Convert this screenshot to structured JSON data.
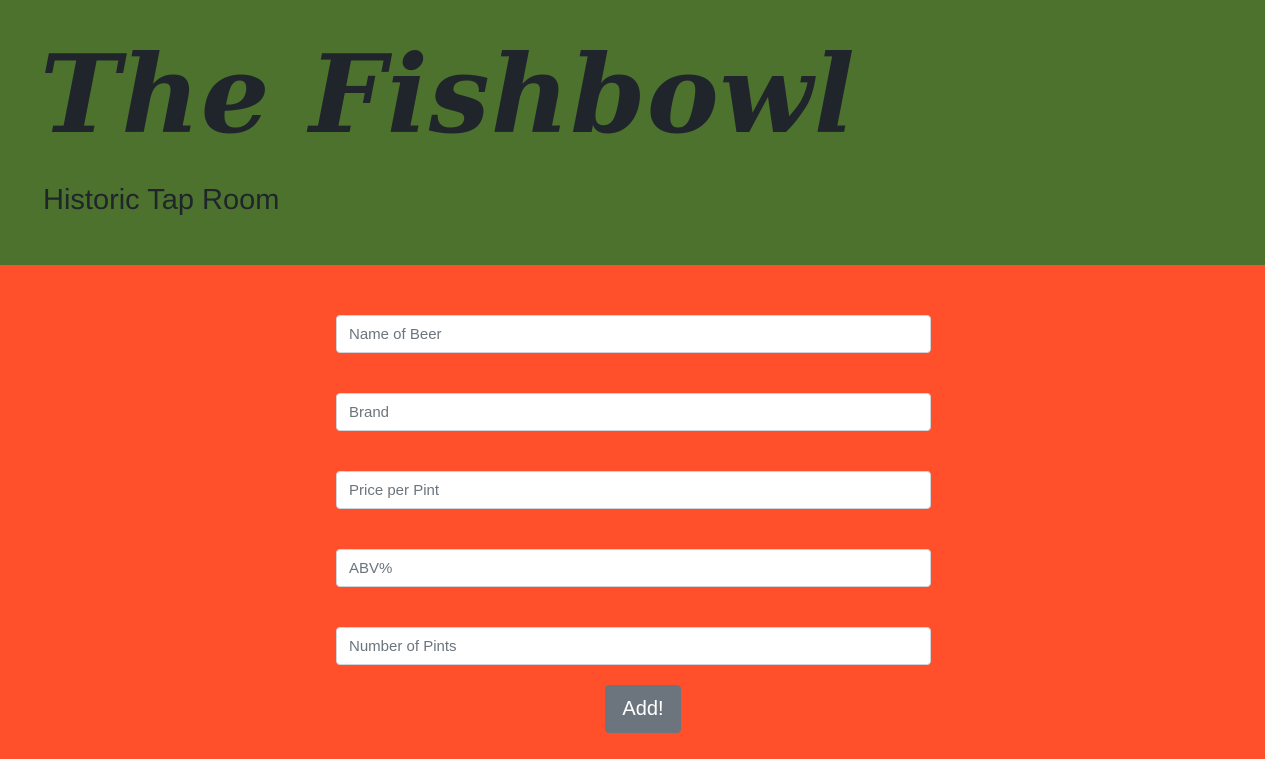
{
  "header": {
    "title": "The Fishbowl",
    "subtitle": "Historic Tap Room"
  },
  "form": {
    "fields": [
      {
        "name": "beer-name-input",
        "placeholder": "Name of Beer",
        "value": ""
      },
      {
        "name": "brand-input",
        "placeholder": "Brand",
        "value": ""
      },
      {
        "name": "price-input",
        "placeholder": "Price per Pint",
        "value": ""
      },
      {
        "name": "abv-input",
        "placeholder": "ABV%",
        "value": ""
      },
      {
        "name": "pints-input",
        "placeholder": "Number of Pints",
        "value": ""
      }
    ],
    "submit_label": "Add!"
  },
  "colors": {
    "header_bg": "#4c722d",
    "main_bg": "#ff4f2b",
    "button_bg": "#6c757d",
    "text_dark": "#1f252b"
  }
}
